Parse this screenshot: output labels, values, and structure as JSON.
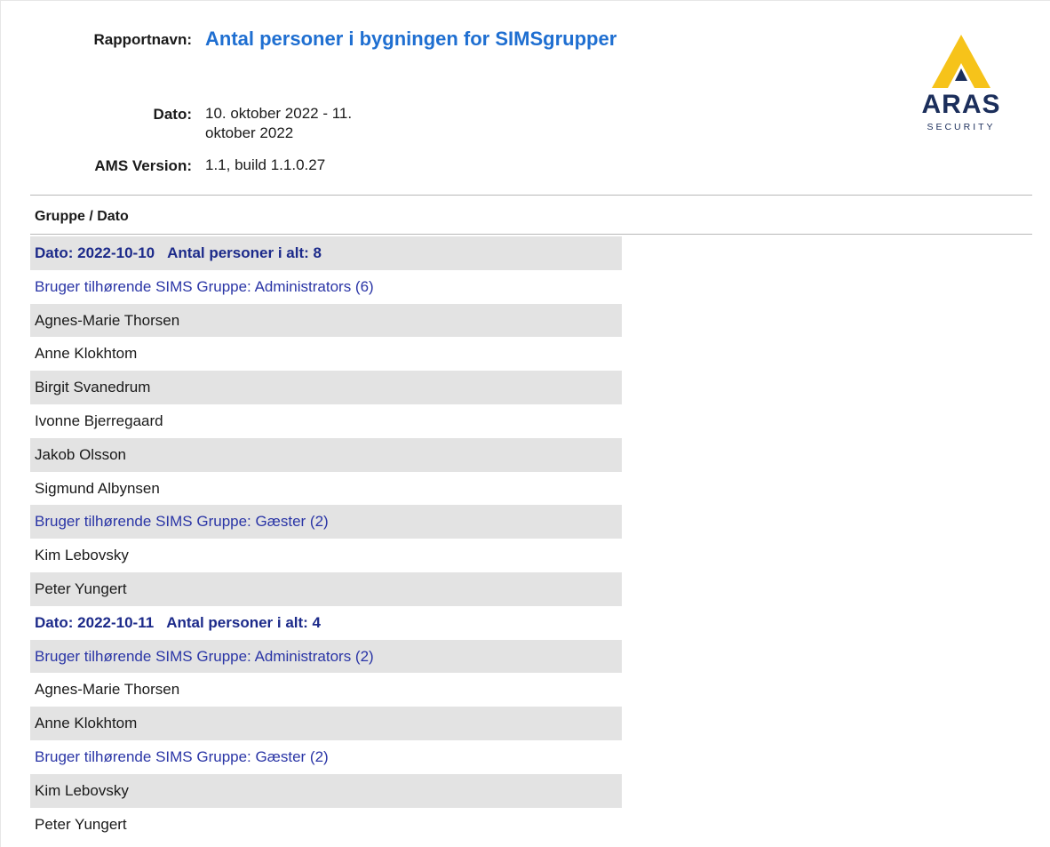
{
  "report": {
    "name_label": "Rapportnavn:",
    "name": "Antal personer i bygningen for SIMSgrupper",
    "date_label": "Dato:",
    "date_line1": "10. oktober 2022 - 11.",
    "date_line2": "oktober 2022",
    "version_label": "AMS Version:",
    "version": "1.1, build 1.1.0.27"
  },
  "logo": {
    "main": "ARAS",
    "sub": "SECURITY",
    "colors": {
      "triangle": "#f6c31a",
      "text": "#1b2e5b"
    }
  },
  "table": {
    "column_header": "Gruppe / Dato",
    "rows": [
      {
        "kind": "date",
        "date": "Dato: 2022-10-10",
        "count": "Antal personer i alt:  8"
      },
      {
        "kind": "group",
        "text": "Bruger tilhørende SIMS Gruppe: Administrators (6)"
      },
      {
        "kind": "person",
        "text": "Agnes-Marie Thorsen"
      },
      {
        "kind": "person",
        "text": "Anne Klokhtom"
      },
      {
        "kind": "person",
        "text": "Birgit Svanedrum"
      },
      {
        "kind": "person",
        "text": "Ivonne Bjerregaard"
      },
      {
        "kind": "person",
        "text": "Jakob Olsson"
      },
      {
        "kind": "person",
        "text": "Sigmund Albynsen"
      },
      {
        "kind": "group",
        "text": "Bruger tilhørende SIMS Gruppe: Gæster (2)"
      },
      {
        "kind": "person",
        "text": "Kim Lebovsky"
      },
      {
        "kind": "person",
        "text": "Peter Yungert"
      },
      {
        "kind": "date",
        "date": "Dato: 2022-10-11",
        "count": "Antal personer i alt:  4"
      },
      {
        "kind": "group",
        "text": "Bruger tilhørende SIMS Gruppe: Administrators (2)"
      },
      {
        "kind": "person",
        "text": "Agnes-Marie Thorsen"
      },
      {
        "kind": "person",
        "text": "Anne Klokhtom"
      },
      {
        "kind": "group",
        "text": "Bruger tilhørende SIMS Gruppe: Gæster (2)"
      },
      {
        "kind": "person",
        "text": "Kim Lebovsky"
      },
      {
        "kind": "person",
        "text": "Peter Yungert"
      }
    ]
  }
}
